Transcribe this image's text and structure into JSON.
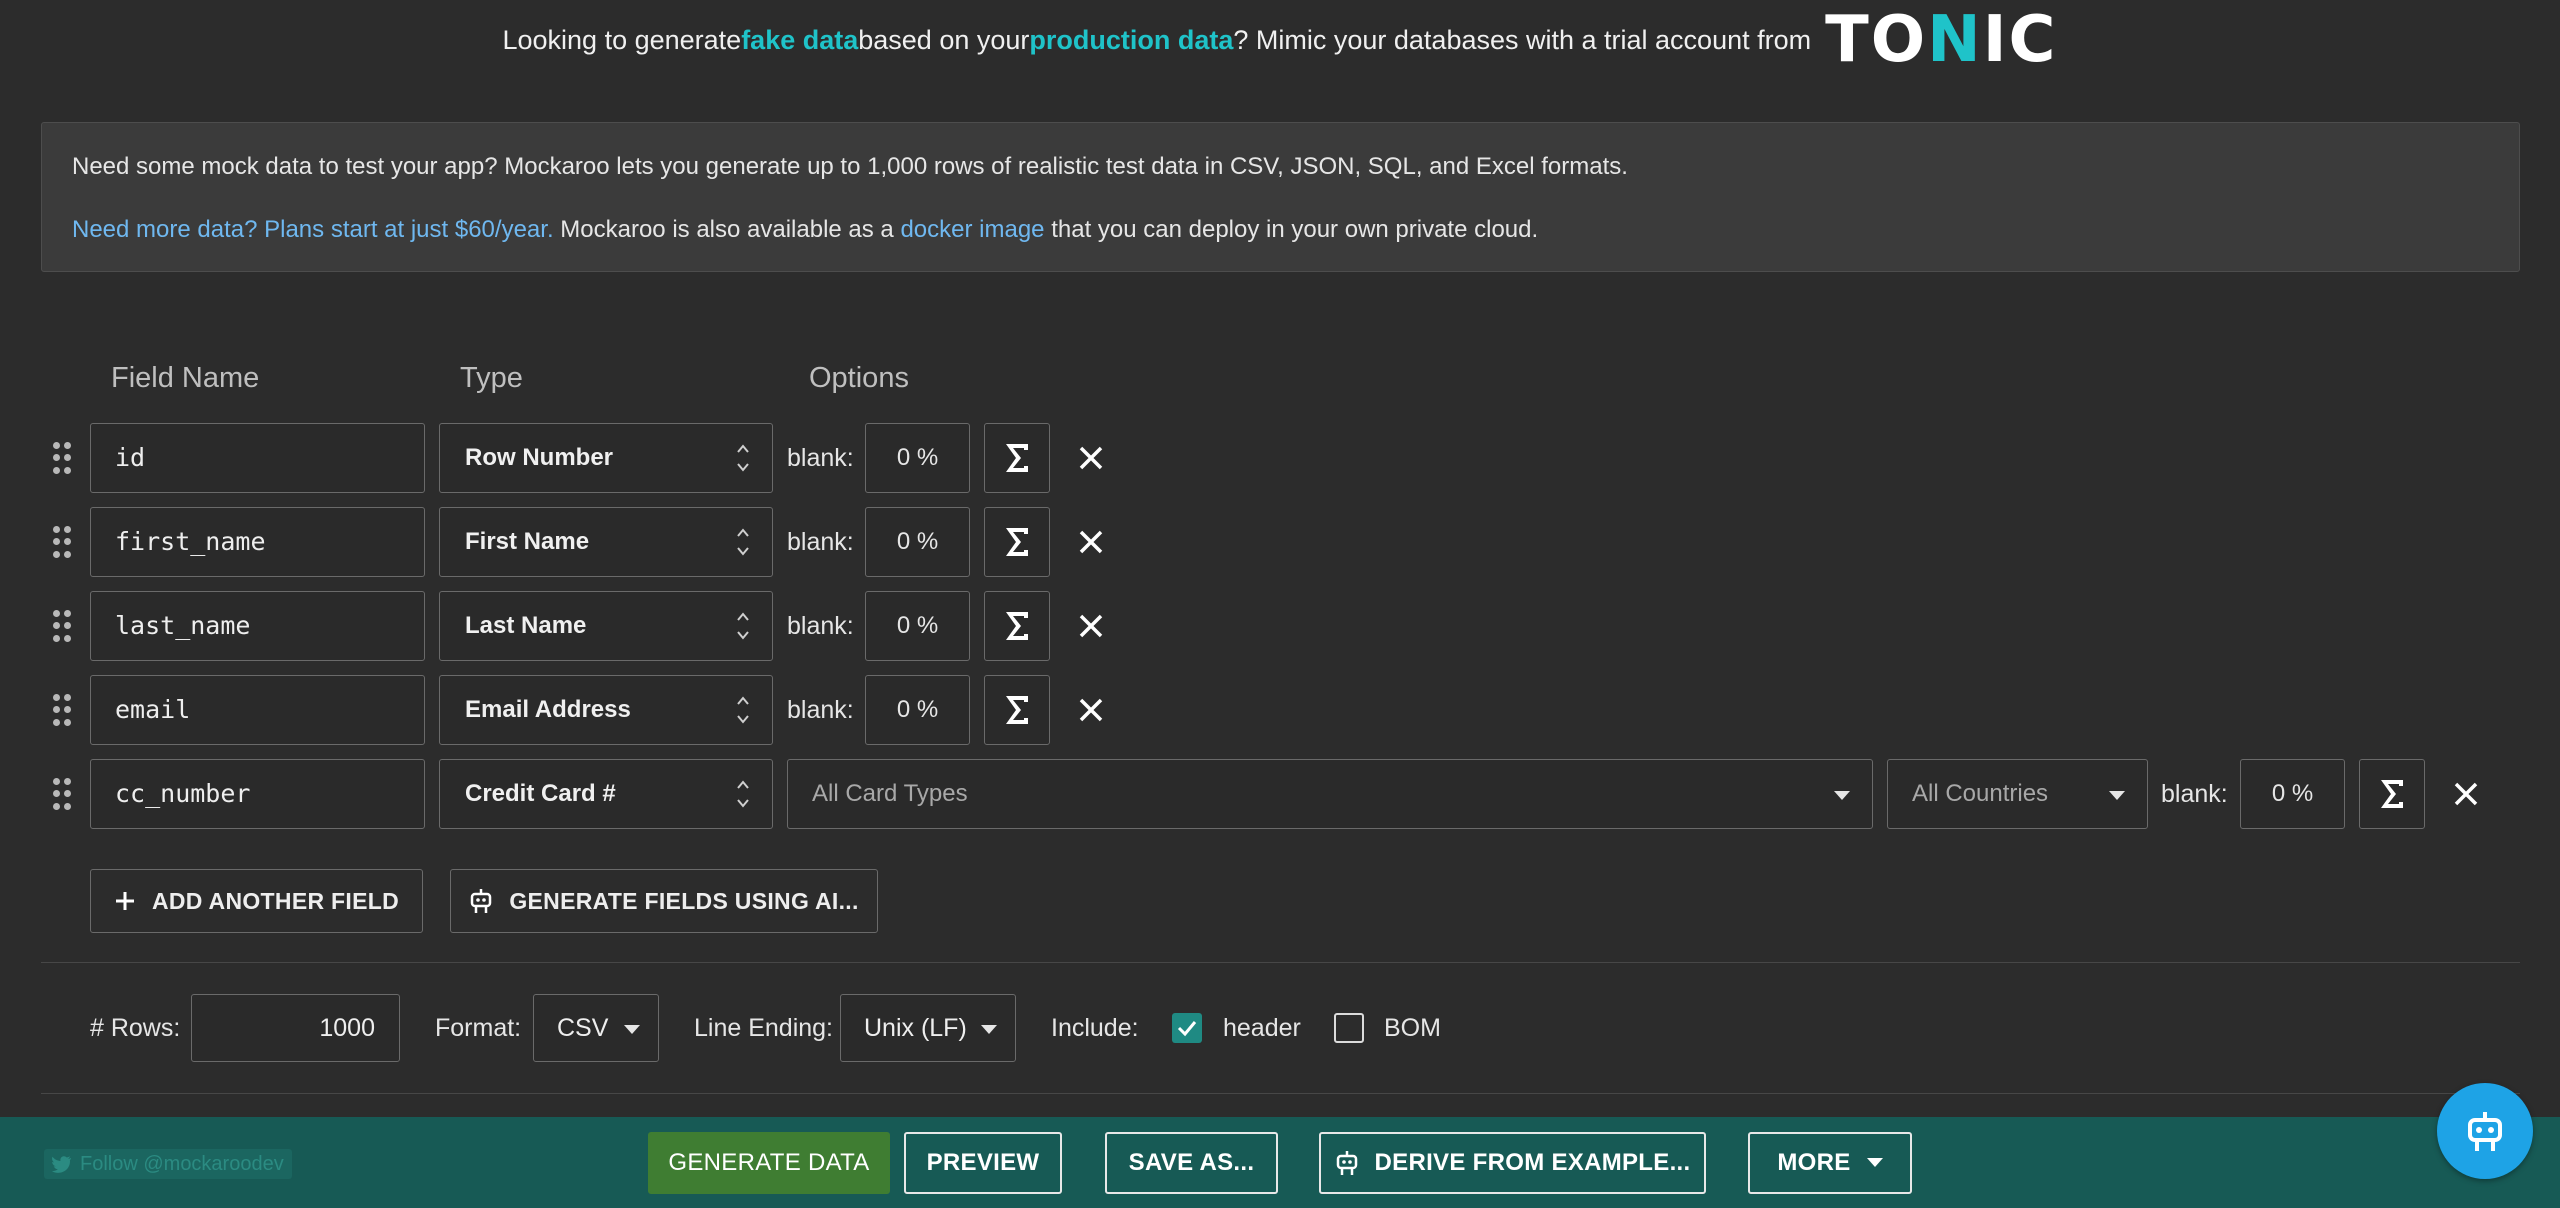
{
  "banner": {
    "t1": "Looking to generate ",
    "hl1": "fake data",
    "t2": " based on your ",
    "hl2": "production data",
    "t3": "? Mimic your databases with a trial account from",
    "brand_a": "TO",
    "brand_b": "N",
    "brand_c": "IC"
  },
  "info": {
    "line1": "Need some mock data to test your app? Mockaroo lets you generate up to 1,000 rows of realistic test data in CSV, JSON, SQL, and Excel formats.",
    "plans_link": "Need more data? Plans start at just $60/year.",
    "line2a": " Mockaroo is also available as a ",
    "docker_link": "docker image",
    "line2b": " that you can deploy in your own private cloud."
  },
  "columns": {
    "field_name": "Field Name",
    "type": "Type",
    "options": "Options"
  },
  "fields": [
    {
      "name": "id",
      "type": "Row Number",
      "blank_label": "blank:",
      "blank": "0 %"
    },
    {
      "name": "first_name",
      "type": "First Name",
      "blank_label": "blank:",
      "blank": "0 %"
    },
    {
      "name": "last_name",
      "type": "Last Name",
      "blank_label": "blank:",
      "blank": "0 %"
    },
    {
      "name": "email",
      "type": "Email Address",
      "blank_label": "blank:",
      "blank": "0 %"
    },
    {
      "name": "cc_number",
      "type": "Credit Card #",
      "card_types": "All Card Types",
      "countries": "All Countries",
      "blank_label": "blank:",
      "blank": "0 %"
    }
  ],
  "actions": {
    "add_field": "ADD ANOTHER FIELD",
    "generate_ai": "GENERATE FIELDS USING AI..."
  },
  "options": {
    "rows_label": "# Rows:",
    "rows_value": "1000",
    "format_label": "Format:",
    "format_value": "CSV",
    "line_ending_label": "Line Ending:",
    "line_ending_value": "Unix (LF)",
    "include_label": "Include:",
    "header_label": "header",
    "header_checked": true,
    "bom_label": "BOM",
    "bom_checked": false
  },
  "footer": {
    "follow": "Follow @mockaroodev",
    "generate": "GENERATE DATA",
    "preview": "PREVIEW",
    "save_as": "SAVE AS...",
    "derive": "DERIVE FROM EXAMPLE...",
    "more": "MORE"
  },
  "colors": {
    "accent": "#1fc3c9",
    "link": "#6fb8f0",
    "footer_bg": "#175a55",
    "primary_button": "#3f7d32",
    "fab": "#1ea3e6"
  },
  "icons": [
    "drag-handle-icon",
    "updown-chevron-icon",
    "sigma-icon",
    "close-icon",
    "plus-icon",
    "robot-icon",
    "caret-down-icon",
    "twitter-icon",
    "checkbox-icon"
  ]
}
